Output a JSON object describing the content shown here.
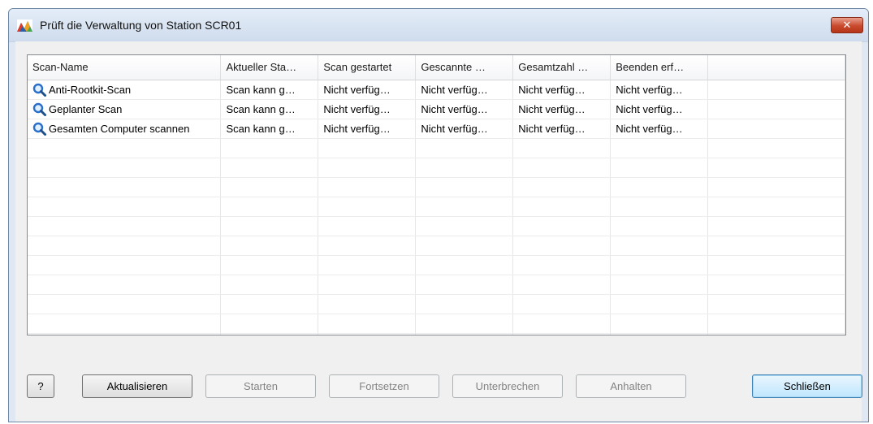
{
  "window": {
    "title": "Prüft die Verwaltung von Station SCR01",
    "close_symbol": "✕"
  },
  "table": {
    "columns": [
      "Scan-Name",
      "Aktueller Sta…",
      "Scan gestartet",
      "Gescannte …",
      "Gesamtzahl …",
      "Beenden erf…",
      ""
    ],
    "rows": [
      {
        "name": "Anti-Rootkit-Scan",
        "status": "Scan kann g…",
        "started": "Nicht verfüg…",
        "scanned": "Nicht verfüg…",
        "total": "Nicht verfüg…",
        "finished": "Nicht verfüg…"
      },
      {
        "name": "Geplanter Scan",
        "status": "Scan kann g…",
        "started": "Nicht verfüg…",
        "scanned": "Nicht verfüg…",
        "total": "Nicht verfüg…",
        "finished": "Nicht verfüg…"
      },
      {
        "name": "Gesamten Computer scannen",
        "status": "Scan kann g…",
        "started": "Nicht verfüg…",
        "scanned": "Nicht verfüg…",
        "total": "Nicht verfüg…",
        "finished": "Nicht verfüg…"
      }
    ],
    "row_icon": "magnifier-icon"
  },
  "buttons": {
    "help": "?",
    "refresh": "Aktualisieren",
    "start": "Starten",
    "resume": "Fortsetzen",
    "pause": "Unterbrechen",
    "stop": "Anhalten",
    "close": "Schließen"
  },
  "colors": {
    "title_gradient_top": "#e4edf8",
    "close_button": "#c94a2e",
    "default_button": "#bee6fd",
    "magnifier": "#2a6fc9"
  }
}
